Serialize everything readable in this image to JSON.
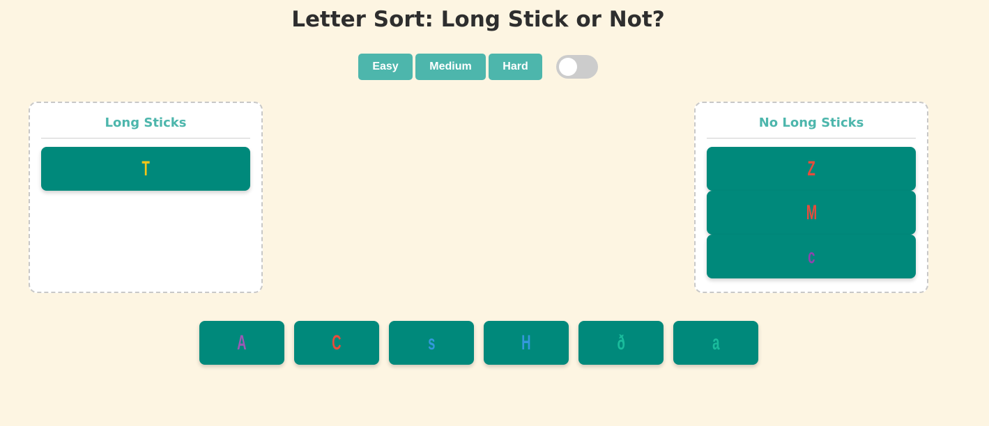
{
  "title": "Letter Sort: Long Stick or Not?",
  "difficulty": {
    "easy": "Easy",
    "medium": "Medium",
    "hard": "Hard",
    "toggle_on": false
  },
  "bins": {
    "left": {
      "title": "Long Sticks",
      "cards": [
        {
          "letter": "T",
          "color": "#f5c518"
        }
      ]
    },
    "right": {
      "title": "No Long Sticks",
      "cards": [
        {
          "letter": "Z",
          "color": "#e74c3c"
        },
        {
          "letter": "M",
          "color": "#e74c3c"
        },
        {
          "letter": "c",
          "color": "#8e44ad"
        }
      ]
    }
  },
  "pool": [
    {
      "letter": "A",
      "color": "#9b59b6"
    },
    {
      "letter": "C",
      "color": "#e74c3c"
    },
    {
      "letter": "s",
      "color": "#3498db"
    },
    {
      "letter": "H",
      "color": "#3498db"
    },
    {
      "letter": "ð",
      "color": "#1abc9c"
    },
    {
      "letter": "a",
      "color": "#1abc9c"
    }
  ],
  "colors": {
    "background": "#fdf5e2",
    "accent": "#4db6ac",
    "card": "#00897b"
  }
}
